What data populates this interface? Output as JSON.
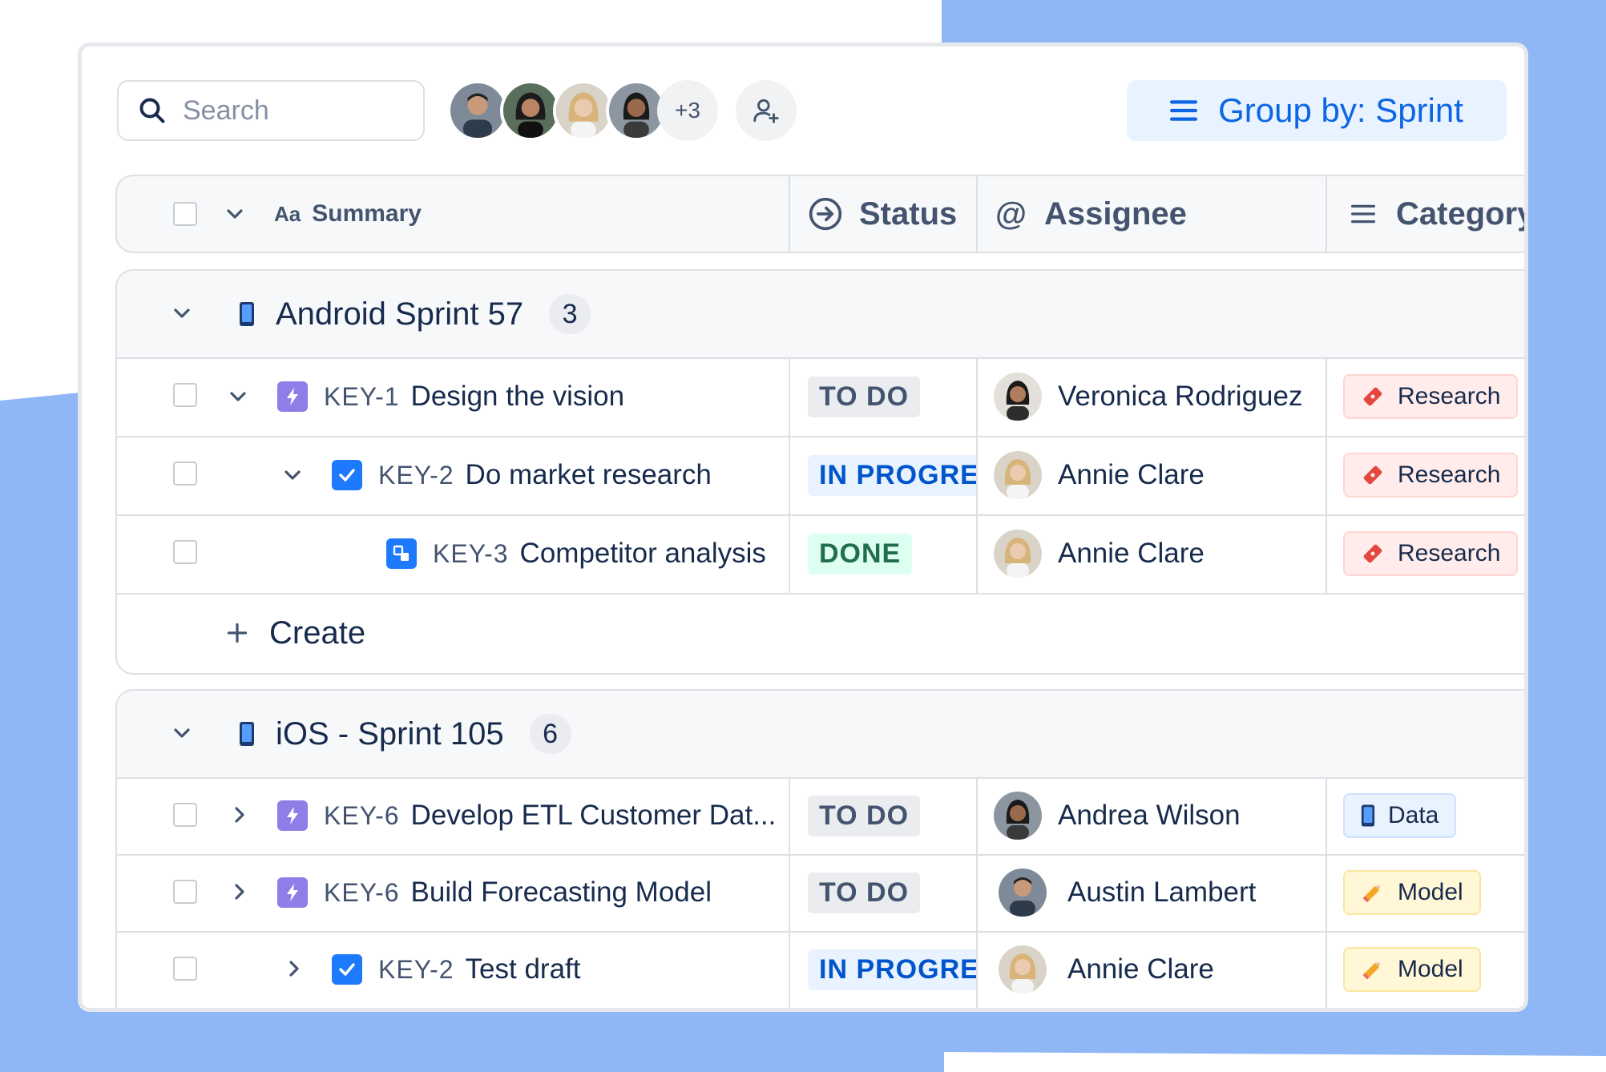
{
  "toolbar": {
    "search_placeholder": "Search",
    "avatar_overflow": "+3",
    "group_by_label": "Group by: Sprint"
  },
  "columns": {
    "summary": "Summary",
    "summary_icon_text": "Aa",
    "status": "Status",
    "assignee": "Assignee",
    "category": "Category"
  },
  "groups": [
    {
      "name": "Android Sprint 57",
      "count": "3",
      "rows": [
        {
          "key": "KEY-1",
          "title": "Design the vision",
          "status": "TO DO",
          "assignee": "Veronica Rodriguez",
          "category": "Research"
        },
        {
          "key": "KEY-2",
          "title": "Do market research",
          "status": "IN PROGRESS",
          "assignee": "Annie Clare",
          "category": "Research"
        },
        {
          "key": "KEY-3",
          "title": "Competitor analysis",
          "status": "DONE",
          "assignee": "Annie Clare",
          "category": "Research"
        }
      ],
      "create_label": "Create"
    },
    {
      "name": "iOS - Sprint 105",
      "count": "6",
      "rows": [
        {
          "key": "KEY-6",
          "title": "Develop ETL Customer Dat...",
          "status": "TO DO",
          "assignee": "Andrea Wilson",
          "category": "Data"
        },
        {
          "key": "KEY-6",
          "title": "Build Forecasting Model",
          "status": "TO DO",
          "assignee": "Austin Lambert",
          "category": "Model"
        },
        {
          "key": "KEY-2",
          "title": "Test draft",
          "status": "IN PROGRESS",
          "assignee": "Annie Clare",
          "category": "Model"
        }
      ]
    }
  ],
  "colors": {
    "accent_blue": "#0C66E4",
    "background_blue": "#8FB7F5",
    "epic_purple": "#8F7EE7",
    "task_blue": "#1D7AFC",
    "done_green": "#216E4E"
  }
}
